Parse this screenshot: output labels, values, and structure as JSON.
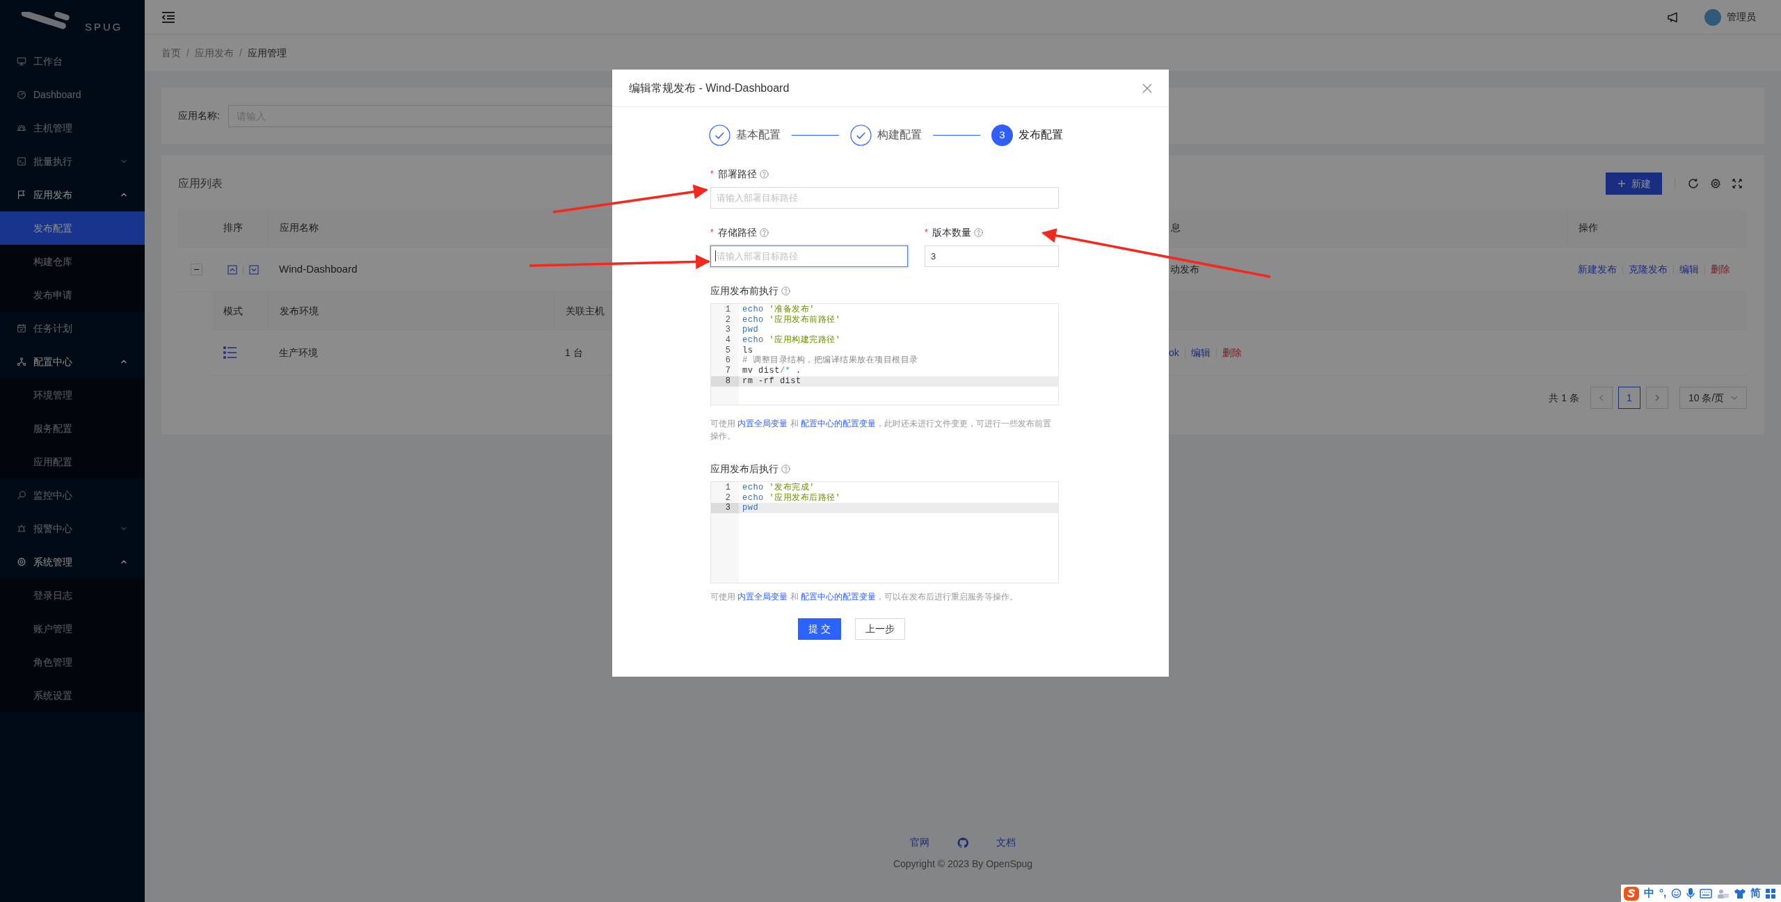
{
  "sidebar": {
    "logo": "SPUG",
    "items": [
      {
        "label": "工作台",
        "selected": false
      },
      {
        "label": "Dashboard",
        "selected": false
      },
      {
        "label": "主机管理",
        "selected": false
      },
      {
        "label": "批量执行",
        "selected": false,
        "expanded": false
      },
      {
        "label": "应用发布",
        "selected": false,
        "expanded": true,
        "children": [
          {
            "label": "发布配置",
            "selected": true
          },
          {
            "label": "构建仓库",
            "selected": false
          },
          {
            "label": "发布申请",
            "selected": false
          }
        ]
      },
      {
        "label": "任务计划",
        "selected": false
      },
      {
        "label": "配置中心",
        "selected": false,
        "expanded": true,
        "children": [
          {
            "label": "环境管理",
            "selected": false
          },
          {
            "label": "服务配置",
            "selected": false
          },
          {
            "label": "应用配置",
            "selected": false
          }
        ]
      },
      {
        "label": "监控中心",
        "selected": false
      },
      {
        "label": "报警中心",
        "selected": false,
        "expanded": false
      },
      {
        "label": "系统管理",
        "selected": false,
        "expanded": true,
        "children": [
          {
            "label": "登录日志",
            "selected": false
          },
          {
            "label": "账户管理",
            "selected": false
          },
          {
            "label": "角色管理",
            "selected": false
          },
          {
            "label": "系统设置",
            "selected": false
          }
        ]
      }
    ]
  },
  "header": {
    "user": "管理员"
  },
  "breadcrumb": {
    "separator": "/",
    "items": [
      "首页",
      "应用发布",
      "应用管理"
    ]
  },
  "search": {
    "label": "应用名称:",
    "placeholder": "请输入"
  },
  "table": {
    "title": "应用列表",
    "new_button": "新建",
    "columns": [
      "排序",
      "应用名称",
      "息",
      "操作"
    ],
    "rows": [
      {
        "name": "Wind-Dashboard",
        "column_3": "动发布",
        "expanded": true,
        "actions": [
          {
            "label": "新建发布",
            "kind": "link"
          },
          {
            "label": "克隆发布",
            "kind": "link"
          },
          {
            "label": "编辑",
            "kind": "link"
          },
          {
            "label": "删除",
            "kind": "danger"
          }
        ],
        "sub_table": {
          "columns": [
            "模式",
            "发布环境",
            "关联主机"
          ],
          "rows": [
            {
              "environment": "生产环境",
              "hosts": "1 台",
              "actions": [
                {
                  "label": "ok",
                  "kind": "link"
                },
                {
                  "label": "编辑",
                  "kind": "link"
                },
                {
                  "label": "删除",
                  "kind": "danger"
                }
              ]
            }
          ]
        }
      }
    ]
  },
  "pagination": {
    "total": "共 1 条",
    "pages": [
      {
        "label": "1",
        "selected": true
      }
    ],
    "page_size": "10 条/页"
  },
  "footer": {
    "links": [
      "官网",
      "文档"
    ],
    "copyright": "Copyright © 2023 By OpenSpug"
  },
  "modal": {
    "title": "编辑常规发布 - Wind-Dashboard",
    "steps": [
      {
        "label": "基本配置",
        "done": true
      },
      {
        "label": "构建配置",
        "done": true
      },
      {
        "label": "发布配置",
        "done": false,
        "number": "3"
      }
    ],
    "field_rows": [
      [
        {
          "label": "部署路径",
          "required_mark": "*",
          "placeholder": "请输入部署目标路径",
          "focused": false
        }
      ],
      [
        {
          "label": "存储路径",
          "required_mark": "*",
          "placeholder": "请输入部署目标路径",
          "focused": true
        },
        {
          "label": "版本数量",
          "required_mark": "*",
          "value": "3",
          "focused": false
        }
      ]
    ],
    "scripts": [
      {
        "label": "应用发布前执行",
        "lines": [
          {
            "number": "1",
            "active": false,
            "tokens": [
              {
                "kind": "builtin",
                "text": "echo"
              },
              {
                "kind": "string",
                "text": " '准备发布'"
              }
            ]
          },
          {
            "number": "2",
            "active": false,
            "tokens": [
              {
                "kind": "builtin",
                "text": "echo"
              },
              {
                "kind": "string",
                "text": " '应用发布前路径'"
              }
            ]
          },
          {
            "number": "3",
            "active": false,
            "tokens": [
              {
                "kind": "builtin",
                "text": "pwd"
              }
            ]
          },
          {
            "number": "4",
            "active": false,
            "tokens": [
              {
                "kind": "builtin",
                "text": "echo"
              },
              {
                "kind": "string",
                "text": " '应用构建完路径'"
              }
            ]
          },
          {
            "number": "5",
            "active": false,
            "tokens": [
              {
                "kind": "plain",
                "text": "ls"
              }
            ]
          },
          {
            "number": "6",
            "active": false,
            "tokens": [
              {
                "kind": "comment",
                "text": "# 调整目录结构，把编译结果放在项目根目录"
              }
            ]
          },
          {
            "number": "7",
            "active": false,
            "tokens": [
              {
                "kind": "plain",
                "text": "mv dist"
              },
              {
                "kind": "operator",
                "text": "/*"
              },
              {
                "kind": "plain",
                "text": " ."
              }
            ]
          },
          {
            "number": "8",
            "active": true,
            "tokens": [
              {
                "kind": "plain",
                "text": "rm -rf dist"
              }
            ]
          }
        ],
        "help": [
          {
            "kind": "text",
            "text": "可使用 "
          },
          {
            "kind": "link",
            "text": "内置全局变量"
          },
          {
            "kind": "text",
            "text": " 和 "
          },
          {
            "kind": "link",
            "text": "配置中心的配置变量"
          },
          {
            "kind": "text",
            "text": "，此时还未进行文件变更，可进行一些发布前置操作。"
          }
        ]
      },
      {
        "label": "应用发布后执行",
        "lines": [
          {
            "number": "1",
            "active": false,
            "tokens": [
              {
                "kind": "builtin",
                "text": "echo"
              },
              {
                "kind": "string",
                "text": " '发布完成'"
              }
            ]
          },
          {
            "number": "2",
            "active": false,
            "tokens": [
              {
                "kind": "builtin",
                "text": "echo"
              },
              {
                "kind": "string",
                "text": " '应用发布后路径'"
              }
            ]
          },
          {
            "number": "3",
            "active": true,
            "tokens": [
              {
                "kind": "builtin",
                "text": "pwd"
              }
            ]
          }
        ],
        "help": [
          {
            "kind": "text",
            "text": "可使用 "
          },
          {
            "kind": "link",
            "text": "内置全局变量"
          },
          {
            "kind": "text",
            "text": " 和 "
          },
          {
            "kind": "link",
            "text": "配置中心的配置变量"
          },
          {
            "kind": "text",
            "text": "，可以在发布后进行重启服务等操作。"
          }
        ]
      }
    ],
    "buttons": [
      {
        "label": "提 交",
        "kind": "primary"
      },
      {
        "label": "上一步",
        "kind": "default"
      }
    ]
  },
  "ime_bar": {
    "items": [
      "中",
      "°,",
      "简"
    ]
  }
}
